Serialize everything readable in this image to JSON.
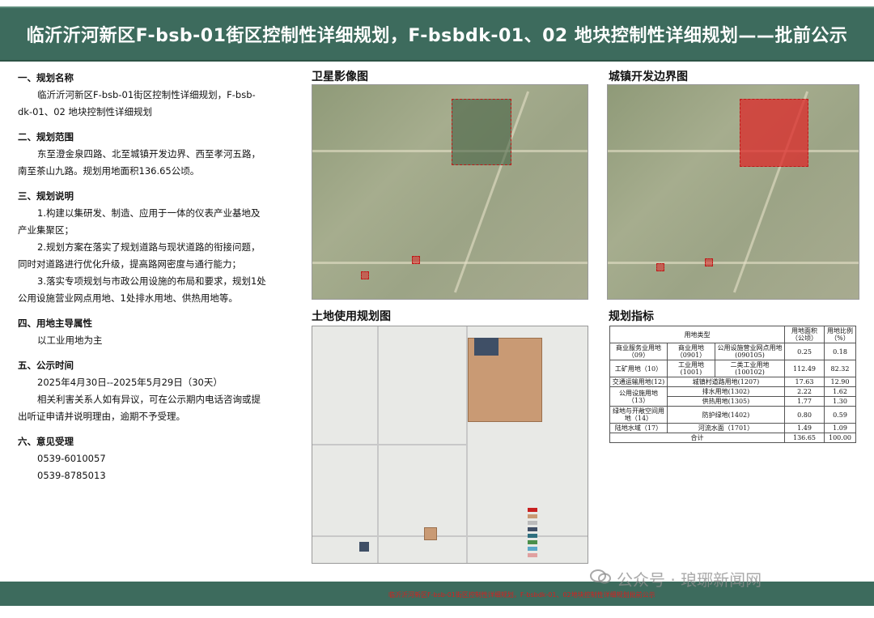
{
  "header": {
    "title": "临沂沂河新区F-bsb-01街区控制性详细规划，F-bsbdk-01、02 地块控制性详细规划——批前公示"
  },
  "sections": {
    "s1": {
      "heading": "一、规划名称",
      "lines": [
        "临沂沂河新区F-bsb-01街区控制性详细规划，F-bsb-",
        "dk-01、02 地块控制性详细规划"
      ]
    },
    "s2": {
      "heading": "二、规划范围",
      "lines": [
        "东至澄金泉四路、北至城镇开发边界、西至孝河五路，",
        "南至茶山九路。规划用地面积136.65公顷。"
      ]
    },
    "s3": {
      "heading": "三、规划说明",
      "lines": [
        "1.构建以集研发、制造、应用于一体的仪表产业基地及",
        "产业集聚区；",
        "2.规划方案在落实了规划道路与现状道路的衔接问题，",
        "同时对道路进行优化升级，提高路网密度与通行能力；",
        "3.落实专项规划与市政公用设施的布局和要求，规划1处",
        "公用设施营业网点用地、1处排水用地、供热用地等。"
      ]
    },
    "s4": {
      "heading": "四、用地主导属性",
      "lines": [
        "以工业用地为主"
      ]
    },
    "s5": {
      "heading": "五、公示时间",
      "lines": [
        "2025年4月30日--2025年5月29日（30天）",
        "相关利害关系人如有异议，可在公示期内电话咨询或提",
        "出听证申请并说明理由，逾期不予受理。"
      ]
    },
    "s6": {
      "heading": "六、意见受理",
      "lines": [
        "0539-6010057",
        "0539-8785013"
      ]
    }
  },
  "panels": {
    "satellite": {
      "title": "卫星影像图"
    },
    "boundary": {
      "title": "城镇开发边界图"
    },
    "landuse": {
      "title": "土地使用规划图"
    },
    "indicators": {
      "title": "规划指标"
    }
  },
  "table": {
    "header": {
      "category": "用地类型",
      "area": "用地面积（公顷）",
      "ratio": "用地比例（%）"
    },
    "rows": [
      {
        "c1": "商业服务业用地（09）",
        "c2": "商业用地（0901）",
        "c3": "公用设施营业网点用地(090105)",
        "area": "0.25",
        "ratio": "0.18"
      },
      {
        "c1": "工矿用地（10）",
        "c2": "工业用地(1001)",
        "c3": "二类工业用地(100102)",
        "area": "112.49",
        "ratio": "82.32"
      },
      {
        "c1": "交通运输用地(12)",
        "c2": "城镇村道路用地(1207)",
        "c3": "",
        "area": "17.63",
        "ratio": "12.90"
      },
      {
        "c1": "公用设施用地（13）",
        "c2": "排水用地(1302)",
        "c3": "",
        "area": "2.22",
        "ratio": "1.62"
      },
      {
        "c1": "",
        "c2": "供热用地(1305)",
        "c3": "",
        "area": "1.77",
        "ratio": "1.30"
      },
      {
        "c1": "绿地与开敞空间用地（14）",
        "c2": "防护绿地(1402)",
        "c3": "",
        "area": "0.80",
        "ratio": "0.59"
      },
      {
        "c1": "陆地水域（17）",
        "c2": "河流水面（1701）",
        "c3": "",
        "area": "1.49",
        "ratio": "1.09"
      }
    ],
    "total": {
      "label": "合计",
      "area": "136.65",
      "ratio": "100.00"
    }
  },
  "watermark": "公众号 · 琅琊新闻网",
  "footer_text": "临沂沂河新区F-bsb-01街区控制性详细规划，F-bsbdk-01、02地块控制性详细规划批前公示"
}
